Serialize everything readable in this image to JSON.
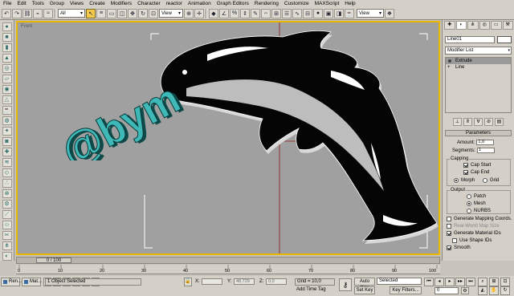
{
  "menu": [
    "File",
    "Edit",
    "Tools",
    "Group",
    "Views",
    "Create",
    "Modifiers",
    "Character",
    "reactor",
    "Animation",
    "Graph Editors",
    "Rendering",
    "Customize",
    "MAXScript",
    "Help"
  ],
  "toolbar": {
    "selection_filter": "All",
    "reference_coord": "View",
    "named_selection": "View"
  },
  "viewport": {
    "label": "Front",
    "logo_text": "@bym"
  },
  "command_panel": {
    "object_name": "Line01",
    "modifier_list": "Modifier List",
    "stack": [
      {
        "label": "Extrude",
        "selected": true
      },
      {
        "label": "Line",
        "selected": false
      }
    ],
    "parameters_title": "Parameters",
    "amount_label": "Amount:",
    "amount_value": "1,0",
    "segments_label": "Segments:",
    "segments_value": "1",
    "capping_title": "Capping",
    "cap_start": "Cap Start",
    "cap_end": "Cap End",
    "morph": "Morph",
    "grid": "Grid",
    "output_title": "Output",
    "patch": "Patch",
    "mesh": "Mesh",
    "nurbs": "NURBS",
    "gen_mapping": "Generate Mapping Coords.",
    "real_world": "Real-World Map Size",
    "gen_material": "Generate Material IDs",
    "use_shape_ids": "Use Shape IDs",
    "smooth": "Smooth"
  },
  "timeline": {
    "slider_label": "0 / 100",
    "ticks": [
      "0",
      "10",
      "20",
      "30",
      "40",
      "50",
      "60",
      "70",
      "80",
      "90",
      "100"
    ]
  },
  "status": {
    "taskbar": [
      "Ren...",
      "Mat..."
    ],
    "selection": "1 Object Selected",
    "x_label": "X:",
    "y_label": "Y:",
    "y_value": "48,729",
    "z_label": "Z:",
    "z_value": "0,0",
    "grid": "Grid = 10,0",
    "add_time_tag": "Add Time Tag",
    "auto_key": "Auto Key",
    "selected": "Selected",
    "set_key": "Set Key",
    "key_filters": "Key Filters...",
    "frame": "0"
  }
}
